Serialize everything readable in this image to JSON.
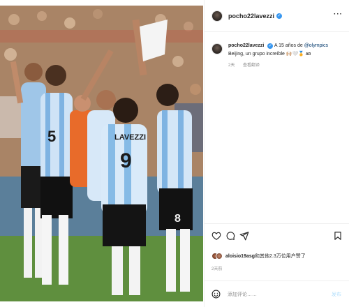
{
  "post": {
    "username": "pocho22lavezzi",
    "caption_text": "A 15 años de ",
    "caption_mention": "@olympics",
    "caption_line2": "Beijing, un grupo increíble 🙌🏼🤍🏅",
    "caption_flag": "AR",
    "time": "2天",
    "translate_label": "查看翻译",
    "likes_user": "aloisio19asg",
    "likes_text": "和其他2.3万位用户赞了",
    "likes_time": "2天前",
    "comment_placeholder": "添加评论……",
    "post_label": "发布",
    "more_label": "···"
  },
  "photo": {
    "jersey_name": "LAVEZZI",
    "jersey_number": "9",
    "left_number": "5",
    "right_number": "8"
  }
}
